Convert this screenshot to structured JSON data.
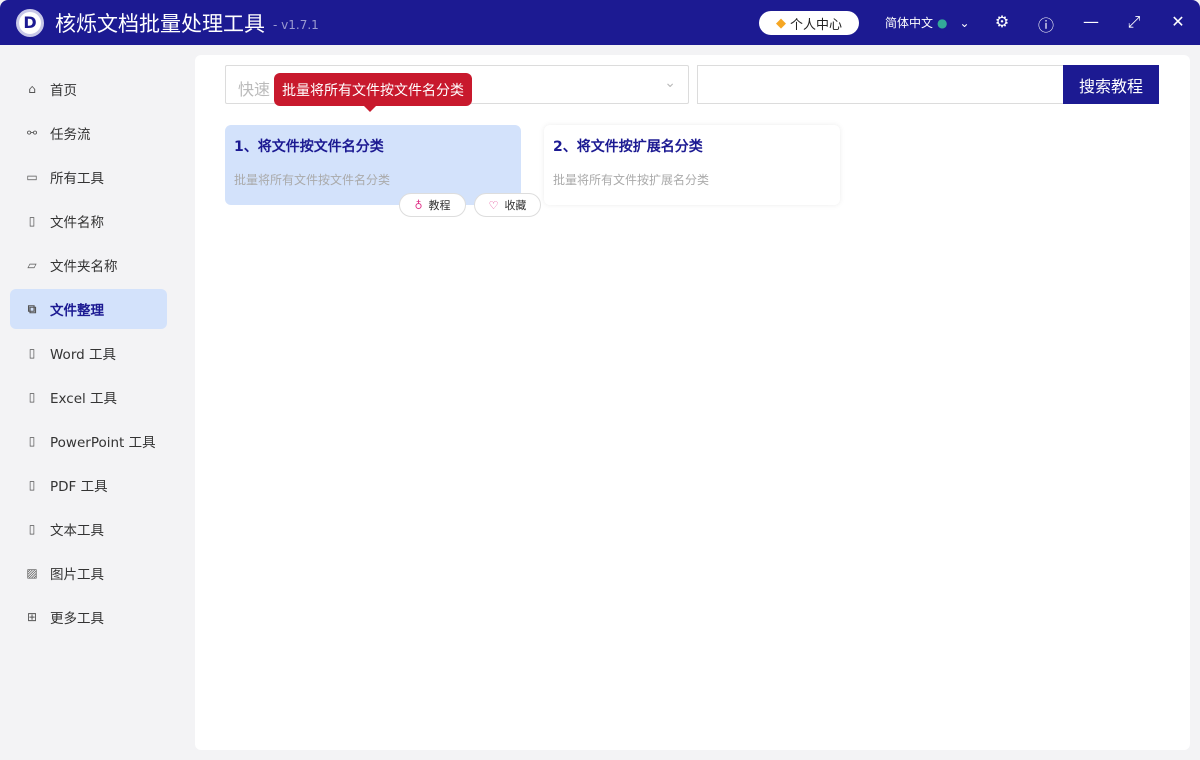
{
  "app": {
    "title": "核烁文档批量处理工具",
    "version": "- v1.7.1",
    "logo_letter": "D"
  },
  "header": {
    "profile": "个人中心",
    "language": "简体中文"
  },
  "sidebar": {
    "items": [
      {
        "label": "首页",
        "icon": "home-icon",
        "glyph": "⌂"
      },
      {
        "label": "任务流",
        "icon": "workflow-icon",
        "glyph": "⚯"
      },
      {
        "label": "所有工具",
        "icon": "monitor-icon",
        "glyph": "▭"
      },
      {
        "label": "文件名称",
        "icon": "file-icon",
        "glyph": "▯"
      },
      {
        "label": "文件夹名称",
        "icon": "folder-icon",
        "glyph": "▱"
      },
      {
        "label": "文件整理",
        "icon": "organize-icon",
        "glyph": "⧉",
        "active": true
      },
      {
        "label": "Word 工具",
        "icon": "word-icon",
        "glyph": "▯"
      },
      {
        "label": "Excel 工具",
        "icon": "excel-icon",
        "glyph": "▯"
      },
      {
        "label": "PowerPoint 工具",
        "icon": "powerpoint-icon",
        "glyph": "▯"
      },
      {
        "label": "PDF 工具",
        "icon": "pdf-icon",
        "glyph": "▯"
      },
      {
        "label": "文本工具",
        "icon": "text-icon",
        "glyph": "▯"
      },
      {
        "label": "图片工具",
        "icon": "image-icon",
        "glyph": "▨"
      },
      {
        "label": "更多工具",
        "icon": "grid-icon",
        "glyph": "⊞"
      }
    ]
  },
  "search": {
    "select_placeholder": "快速",
    "button": "搜索教程"
  },
  "tooltip": "批量将所有文件按文件名分类",
  "cards": [
    {
      "title": "1、将文件按文件名分类",
      "desc": "批量将所有文件按文件名分类"
    },
    {
      "title": "2、将文件按扩展名分类",
      "desc": "批量将所有文件按扩展名分类"
    }
  ],
  "card_actions": {
    "tutorial": "教程",
    "favorite": "收藏"
  }
}
